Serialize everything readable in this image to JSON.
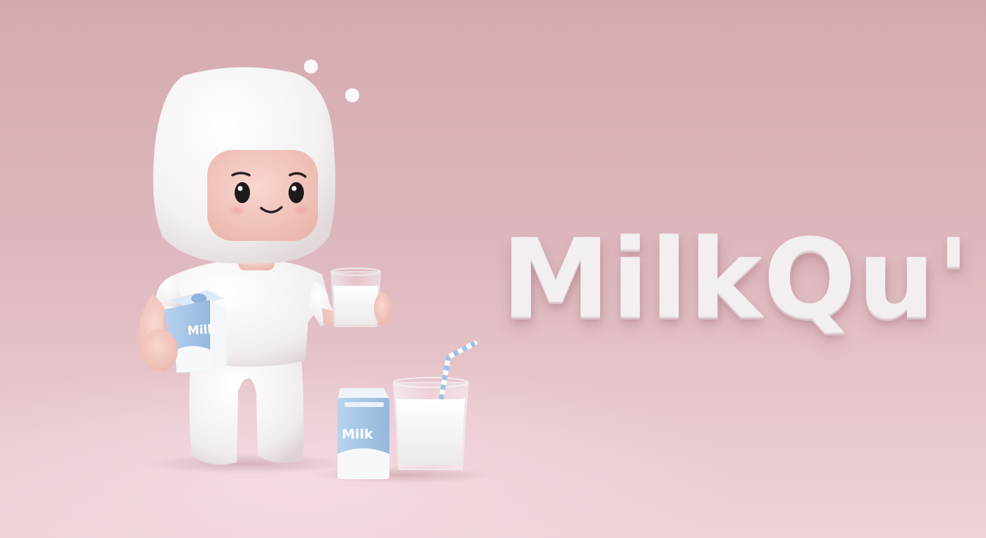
{
  "brand": {
    "logo_text": "MilkQu'"
  },
  "cartons": {
    "held_label": "Milk",
    "floor_label": "Milk"
  },
  "colors": {
    "background": "#d9b3b9",
    "logo": "#f3eeef",
    "carton_blue": "#a9c9ea",
    "mascot_white": "#f7f5f5",
    "skin": "#f3c9c2"
  }
}
